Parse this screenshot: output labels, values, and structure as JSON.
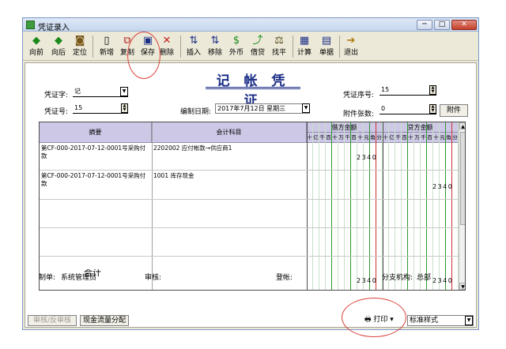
{
  "window": {
    "title": "凭证录入",
    "min": "─",
    "max": "□",
    "close": "✕"
  },
  "toolbar": [
    {
      "label": "向前",
      "icon": "◆"
    },
    {
      "label": "向后",
      "icon": "◆"
    },
    {
      "label": "定位",
      "icon": "◙"
    },
    {
      "label": "新增",
      "icon": "▯"
    },
    {
      "label": "复制",
      "icon": "⧉"
    },
    {
      "label": "保存",
      "icon": "▣"
    },
    {
      "label": "删除",
      "icon": "✕"
    },
    {
      "label": "插入",
      "icon": "⇅"
    },
    {
      "label": "移除",
      "icon": "⇅"
    },
    {
      "label": "外币",
      "icon": "$"
    },
    {
      "label": "借贷",
      "icon": "⤴"
    },
    {
      "label": "找平",
      "icon": "⚖"
    },
    {
      "label": "计算",
      "icon": "▦"
    },
    {
      "label": "单据",
      "icon": "▤"
    },
    {
      "label": "退出",
      "icon": "➔"
    }
  ],
  "voucher": {
    "title": "记 帐 凭 证",
    "type_label": "凭证字:",
    "type_value": "记",
    "number_label": "凭证号:",
    "number_value": "15",
    "date_label": "编制日期:",
    "date_value": "2017年7月12日 星期三",
    "seq_label": "凭证序号:",
    "seq_value": "15",
    "attach_label": "附件张数:",
    "attach_value": "0",
    "attach_button": "附件"
  },
  "grid": {
    "col_summary": "摘要",
    "col_account": "会计科目",
    "col_debit": "借方金额",
    "col_credit": "贷方金额",
    "digits": [
      "十",
      "亿",
      "千",
      "百",
      "十",
      "万",
      "千",
      "百",
      "十",
      "元",
      "角",
      "分"
    ],
    "rows": [
      {
        "summary": "第CF-000-2017-07-12-0001号采购付款",
        "account": "2202002 应付帐款→供应商1",
        "debit": "2340",
        "credit": ""
      },
      {
        "summary": "第CF-000-2017-07-12-0001号采购付款",
        "account": "1001 库存现金",
        "debit": "",
        "credit": "2340"
      },
      {
        "summary": "",
        "account": "",
        "debit": "",
        "credit": ""
      },
      {
        "summary": "",
        "account": "",
        "debit": "",
        "credit": ""
      }
    ],
    "total_label": "合计",
    "total_debit": "2340",
    "total_credit": "2340"
  },
  "footer": {
    "maker_label": "制单:",
    "maker_value": "系统管理员",
    "audit_label": "审核:",
    "post_label": "登帐:",
    "branch_label": "分支机构:",
    "branch_value": "总部"
  },
  "bottom": {
    "audit_button": "审核/反审核",
    "cashflow_button": "现金流量分配",
    "print_button": "打印",
    "style_value": "标准样式"
  }
}
